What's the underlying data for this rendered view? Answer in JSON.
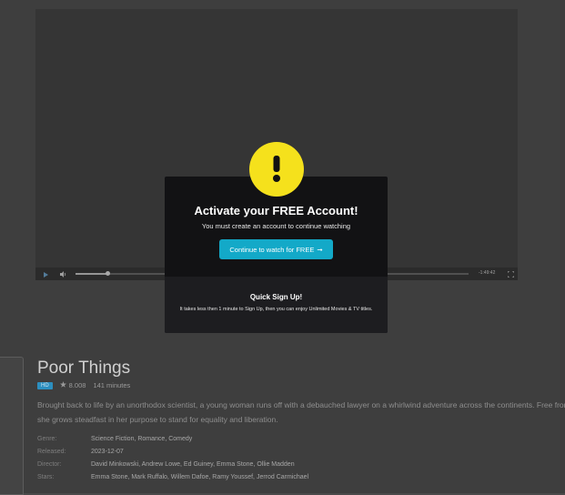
{
  "player": {
    "time_remaining": "-1:49:42",
    "progress": 0.08
  },
  "modal": {
    "title": "Activate your FREE Account!",
    "subtitle": "You must create an account to continue watching",
    "cta_label": "Continue to watch for FREE",
    "cta_arrow": "➞",
    "quick_title": "Quick Sign Up!",
    "quick_text": "It takes less then 1 minute to Sign Up, then you can enjoy Unlimited Movies & TV titles.",
    "icon": "exclamation-icon",
    "icon_color": "#f5e11c",
    "cta_color": "#13a9c8"
  },
  "movie": {
    "title": "Poor Things",
    "badge": "HD",
    "rating": "8.008",
    "duration": "141 minutes",
    "description_line1": "Brought back to life by an unorthodox scientist, a young woman runs off with a debauched lawyer on a whirlwind adventure across the continents. Free from the p",
    "description_line2": "she grows steadfast in her purpose to stand for equality and liberation.",
    "details": [
      {
        "label": "Genre:",
        "value": "Science Fiction, Romance, Comedy"
      },
      {
        "label": "Released:",
        "value": "2023-12-07"
      },
      {
        "label": "Director:",
        "value": "David Minkowski, Andrew Lowe, Ed Guiney, Emma Stone, Ollie Madden"
      },
      {
        "label": "Stars:",
        "value": "Emma Stone, Mark Ruffalo, Willem Dafoe, Ramy Youssef, Jerrod Carmichael"
      }
    ]
  }
}
